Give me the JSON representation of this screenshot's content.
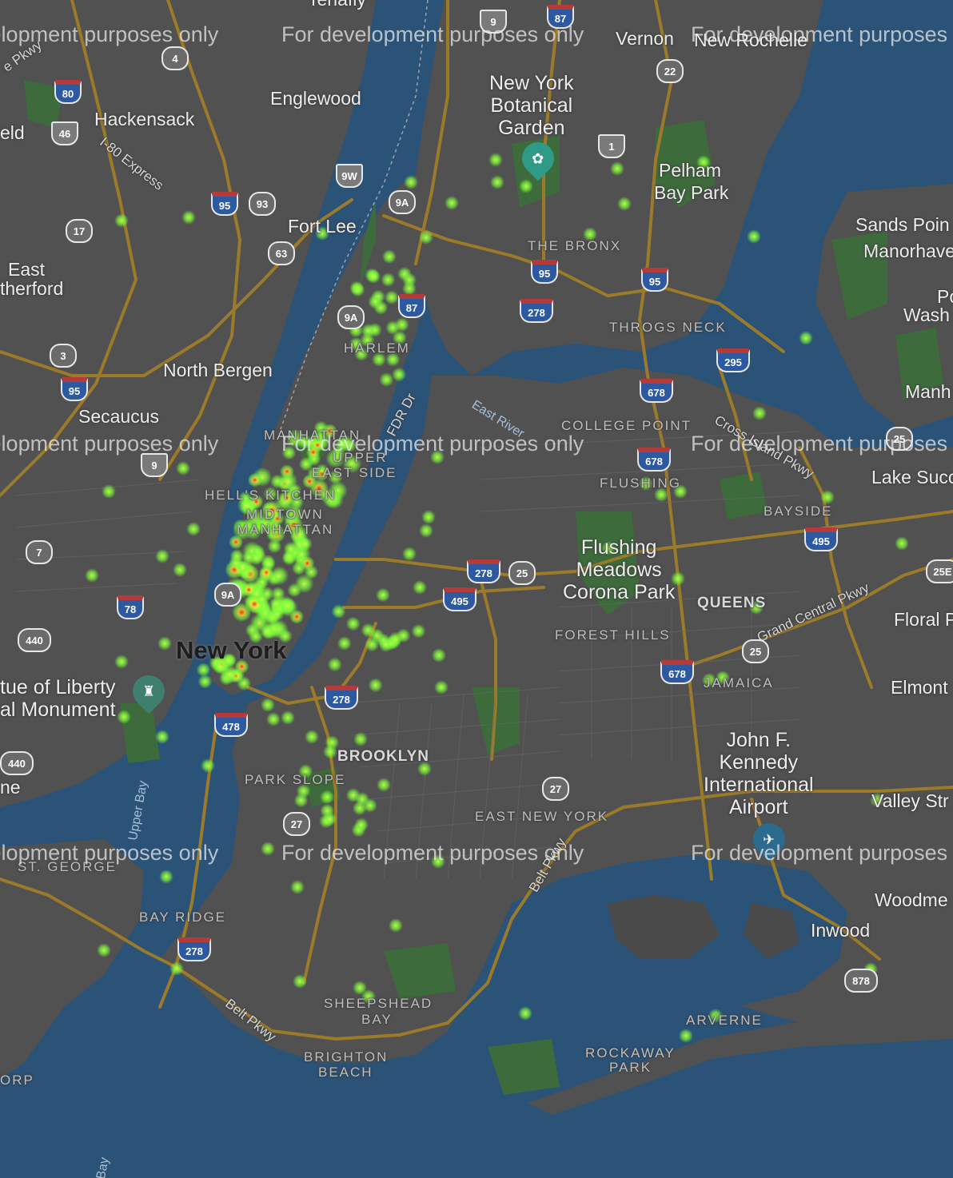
{
  "map": {
    "watermark_text": "For development purposes only",
    "colors": {
      "water": "#2b5277",
      "land": "#515151",
      "park": "#3d6b3b",
      "highway": "#9b7b2a",
      "heat_low": "#7dff3a",
      "heat_mid": "#ffe633",
      "heat_high": "#ff1f1f"
    }
  },
  "labels": {
    "places": [
      {
        "name": "Englewood"
      },
      {
        "name": "Hackensack"
      },
      {
        "name": "Fort Lee"
      },
      {
        "name": "North Bergen"
      },
      {
        "name": "Secaucus"
      },
      {
        "name": "East"
      },
      {
        "name": "therford"
      },
      {
        "name": "eld"
      },
      {
        "name": "Pelham"
      },
      {
        "name": "Bay Park"
      },
      {
        "name": "Sands Poin"
      },
      {
        "name": "Manorhave"
      },
      {
        "name": "Po"
      },
      {
        "name": "Wash"
      },
      {
        "name": "Manh"
      },
      {
        "name": "Lake Succ"
      },
      {
        "name": "Floral P"
      },
      {
        "name": "Elmont"
      },
      {
        "name": "Valley Str"
      },
      {
        "name": "Woodme"
      },
      {
        "name": "Inwood"
      },
      {
        "name": "ne"
      },
      {
        "name": "Vernon"
      },
      {
        "name": "New Rochelle"
      }
    ],
    "parks": [
      {
        "line1": "New York",
        "line2": "Botanical",
        "line3": "Garden"
      },
      {
        "line1": "Flushing",
        "line2": "Meadows",
        "line3": "Corona Park"
      },
      {
        "line1": "John F.",
        "line2": "Kennedy",
        "line3": "International",
        "line4": "Airport"
      },
      {
        "line1": "tue of Liberty",
        "line2": "al Monument"
      }
    ],
    "districts": [
      {
        "name": "THE BRONX"
      },
      {
        "name": "HARLEM"
      },
      {
        "name": "THROGS NECK"
      },
      {
        "name": "COLLEGE POINT"
      },
      {
        "name": "FLUSHING"
      },
      {
        "name": "BAYSIDE"
      },
      {
        "name": "MANHATTAN"
      },
      {
        "name": "UPPER"
      },
      {
        "name": "EAST SIDE"
      },
      {
        "name": "HELL'S KITCHEN"
      },
      {
        "name": "MIDTOWN"
      },
      {
        "name": "MANHATTAN"
      },
      {
        "name": "FOREST HILLS"
      },
      {
        "name": "JAMAICA"
      },
      {
        "name": "PARK SLOPE"
      },
      {
        "name": "EAST NEW YORK"
      },
      {
        "name": "ST. GEORGE"
      },
      {
        "name": "BAY RIDGE"
      },
      {
        "name": "SHEEPSHEAD"
      },
      {
        "name": "BAY"
      },
      {
        "name": "BRIGHTON"
      },
      {
        "name": "BEACH"
      },
      {
        "name": "ARVERNE"
      },
      {
        "name": "ROCKAWAY"
      },
      {
        "name": "PARK"
      },
      {
        "name": "ORP"
      }
    ],
    "city": "New York",
    "boroughs": [
      {
        "name": "QUEENS"
      },
      {
        "name": "BROOKLYN"
      }
    ],
    "roads": [
      {
        "name": "I-80 Express"
      },
      {
        "name": "FDR Dr"
      },
      {
        "name": "Cross Island Pkwy"
      },
      {
        "name": "Grand Central Pkwy"
      },
      {
        "name": "Belt Pkwy"
      },
      {
        "name": "Belt Pkwy"
      },
      {
        "name": "e Pkwy"
      }
    ],
    "water": [
      {
        "name": "East River"
      },
      {
        "name": "Upper Bay"
      },
      {
        "name": "Bay"
      }
    ],
    "top_cut": "Tenafly"
  },
  "shields": [
    {
      "num": "4",
      "kind": "route"
    },
    {
      "num": "80",
      "kind": "interstate"
    },
    {
      "num": "46",
      "kind": "us"
    },
    {
      "num": "17",
      "kind": "route"
    },
    {
      "num": "95",
      "kind": "interstate"
    },
    {
      "num": "93",
      "kind": "route"
    },
    {
      "num": "63",
      "kind": "route"
    },
    {
      "num": "9W",
      "kind": "us"
    },
    {
      "num": "9A",
      "kind": "route"
    },
    {
      "num": "9",
      "kind": "us"
    },
    {
      "num": "87",
      "kind": "interstate"
    },
    {
      "num": "22",
      "kind": "route"
    },
    {
      "num": "1",
      "kind": "us"
    },
    {
      "num": "95",
      "kind": "interstate"
    },
    {
      "num": "95",
      "kind": "interstate"
    },
    {
      "num": "278",
      "kind": "interstate"
    },
    {
      "num": "87",
      "kind": "interstate"
    },
    {
      "num": "9A",
      "kind": "route"
    },
    {
      "num": "295",
      "kind": "interstate"
    },
    {
      "num": "3",
      "kind": "route"
    },
    {
      "num": "95",
      "kind": "interstate"
    },
    {
      "num": "678",
      "kind": "interstate"
    },
    {
      "num": "9",
      "kind": "us"
    },
    {
      "num": "678",
      "kind": "interstate"
    },
    {
      "num": "495",
      "kind": "interstate"
    },
    {
      "num": "7",
      "kind": "route"
    },
    {
      "num": "278",
      "kind": "interstate"
    },
    {
      "num": "25",
      "kind": "route"
    },
    {
      "num": "495",
      "kind": "interstate"
    },
    {
      "num": "9A",
      "kind": "route"
    },
    {
      "num": "78",
      "kind": "interstate"
    },
    {
      "num": "440",
      "kind": "route"
    },
    {
      "num": "25",
      "kind": "route"
    },
    {
      "num": "678",
      "kind": "interstate"
    },
    {
      "num": "278",
      "kind": "interstate"
    },
    {
      "num": "478",
      "kind": "interstate"
    },
    {
      "num": "440",
      "kind": "route"
    },
    {
      "num": "27",
      "kind": "route"
    },
    {
      "num": "27",
      "kind": "route"
    },
    {
      "num": "278",
      "kind": "interstate"
    },
    {
      "num": "878",
      "kind": "route"
    },
    {
      "num": "25E",
      "kind": "route"
    },
    {
      "num": "25",
      "kind": "route"
    }
  ],
  "heatmap": {
    "point_count": 230
  }
}
